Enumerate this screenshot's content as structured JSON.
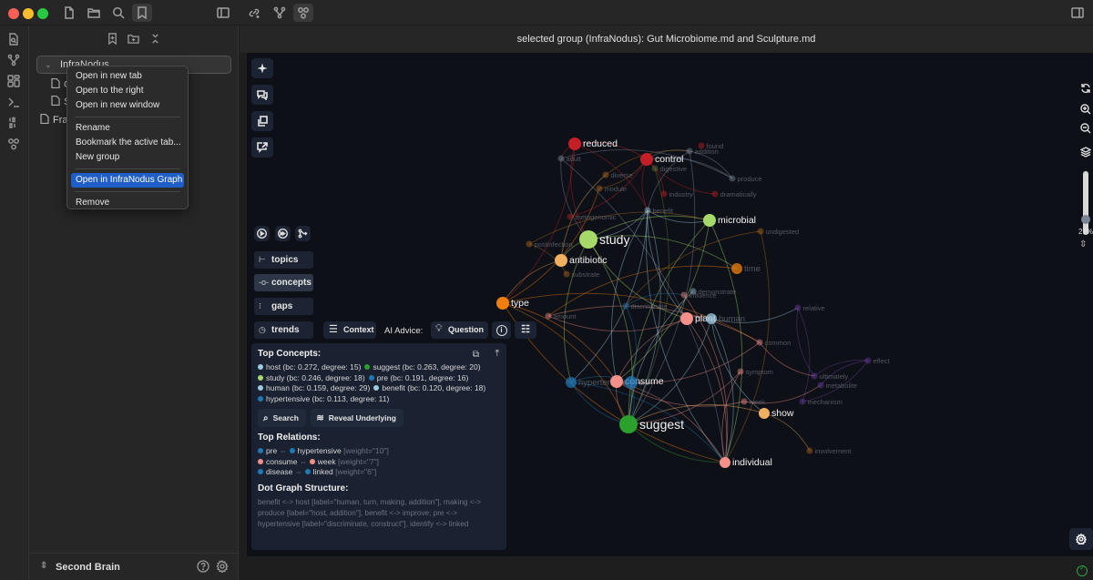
{
  "window": {
    "traffic_lights": {
      "close": "#fe5f57",
      "minimize": "#febc2e",
      "maximize": "#28c840"
    },
    "titlebar_icons": [
      "new-file-icon",
      "folder-icon",
      "search-icon",
      "bookmark-icon",
      "sidebar-toggle-icon",
      "link-plus-icon",
      "graph-icon",
      "infranodus-graph-icon",
      "right-sidebar-toggle-icon"
    ]
  },
  "ribbon": {
    "icons": [
      "file-search-icon",
      "graph-view-icon",
      "dashboard-icon",
      "terminal-icon",
      "binary-icon",
      "infranodus-icon"
    ]
  },
  "sidebar": {
    "header_icons": [
      "bookmark-add-icon",
      "new-folder-icon",
      "collapse-icon"
    ],
    "group": {
      "label": "InfraNodus"
    },
    "files": [
      {
        "label": "G"
      },
      {
        "label": "S"
      }
    ],
    "root_file": {
      "label": "Fra"
    },
    "vault_name": "Second Brain",
    "footer_icons": [
      "help-icon",
      "settings-icon"
    ]
  },
  "context_menu": {
    "items": [
      {
        "label": "Open in new tab"
      },
      {
        "label": "Open to the right"
      },
      {
        "label": "Open in new window"
      },
      {
        "label": "Rename"
      },
      {
        "label": "Bookmark the active tab..."
      },
      {
        "label": "New group"
      },
      {
        "label": "Open in InfraNodus Graph",
        "highlighted": true
      },
      {
        "label": "Remove"
      }
    ],
    "highlight_color": "#1f5ec9"
  },
  "main": {
    "tab_title": "selected group (InfraNodus): Gut Microbiome.md and Sculpture.md",
    "floating_buttons": [
      "sparkle-icon",
      "chat-icon",
      "copy-icon",
      "share-chat-icon"
    ],
    "playback": [
      "play-icon",
      "fast-forward-icon",
      "branch-icon"
    ],
    "view_pills": [
      {
        "label": "topics",
        "icon": "⊢"
      },
      {
        "label": "concepts",
        "icon": "-o-",
        "active": true
      },
      {
        "label": "gaps",
        "icon": "⁝"
      },
      {
        "label": "trends",
        "icon": "◷"
      }
    ],
    "context_button": "Context",
    "ai_advice_label": "AI Advice:",
    "question_button": "Question",
    "zoom_percent": "29%",
    "zoom_slider_value": 0.29
  },
  "panel": {
    "top_concepts_title": "Top Concepts:",
    "concepts": [
      {
        "text": "host (bc: 0.272, degree: 15)",
        "color": "#9ecae1"
      },
      {
        "text": "suggest (bc: 0.263, degree: 20)",
        "color": "#2ca02c"
      },
      {
        "text": "study (bc: 0.246, degree: 18)",
        "color": "#a6d96a"
      },
      {
        "text": "pre (bc: 0.191, degree: 16)",
        "color": "#1f77b4"
      },
      {
        "text": "human (bc: 0.159, degree: 29)",
        "color": "#9ecae1"
      },
      {
        "text": "benefit (bc: 0.120, degree: 18)",
        "color": "#9ecae1"
      },
      {
        "text": "hypertensive (bc: 0.113, degree: 11)",
        "color": "#1f77b4"
      }
    ],
    "search_button": "Search",
    "reveal_button": "Reveal Underlying",
    "top_relations_title": "Top Relations:",
    "relations": [
      {
        "a": "pre",
        "a_color": "#1f77b4",
        "b": "hypertensive",
        "b_color": "#1f77b4",
        "weight": "[weight=\"10\"]"
      },
      {
        "a": "consume",
        "a_color": "#f4908a",
        "b": "week",
        "b_color": "#f4908a",
        "weight": "[weight=\"7\"]"
      },
      {
        "a": "disease",
        "a_color": "#1f77b4",
        "b": "linked",
        "b_color": "#1f77b4",
        "weight": "[weight=\"6\"]"
      }
    ],
    "dot_title": "Dot Graph Structure:",
    "dot_text": "benefit <-> host [label=\"human, turn, making, addition\"], making <-> produce [label=\"host, addition\"], benefit <-> improve; pre <-> hypertensive [label=\"discriminate, construct\"], identify <-> linked"
  },
  "graph": {
    "nodes": [
      {
        "id": "reduced",
        "label": "reduced",
        "color": "#c41e26",
        "size": "medium",
        "prominent": true
      },
      {
        "id": "control",
        "label": "control",
        "color": "#c41e26",
        "size": "medium",
        "prominent": true
      },
      {
        "id": "found",
        "label": "found",
        "color": "#c41e26",
        "size": "tiny"
      },
      {
        "id": "addition",
        "label": "addition",
        "color": "#7a8a99",
        "size": "tiny"
      },
      {
        "id": "adult",
        "label": "adult",
        "color": "#7a8a99",
        "size": "tiny"
      },
      {
        "id": "produce",
        "label": "produce",
        "color": "#7a8a99",
        "size": "tiny"
      },
      {
        "id": "digestive",
        "label": "digestive",
        "color": "#5b7a3a",
        "size": "tiny"
      },
      {
        "id": "diverse",
        "label": "diverse",
        "color": "#b0691e",
        "size": "tiny"
      },
      {
        "id": "module",
        "label": "module",
        "color": "#b0691e",
        "size": "tiny"
      },
      {
        "id": "dramatically",
        "label": "dramatically",
        "color": "#c41e26",
        "size": "tiny"
      },
      {
        "id": "industry",
        "label": "industry",
        "color": "#c41e26",
        "size": "tiny"
      },
      {
        "id": "benefit",
        "label": "benefit",
        "color": "#9ecae1",
        "size": "tiny"
      },
      {
        "id": "metagenomic",
        "label": "metagenomic",
        "color": "#c41e26",
        "size": "tiny"
      },
      {
        "id": "microbial",
        "label": "microbial",
        "color": "#a6d96a",
        "size": "medium",
        "prominent": true
      },
      {
        "id": "undigested",
        "label": "undigested",
        "color": "#b0691e",
        "size": "tiny"
      },
      {
        "id": "study",
        "label": "study",
        "color": "#a6d96a",
        "size": "large",
        "prominent": true
      },
      {
        "id": "postinfection",
        "label": "postinfection",
        "color": "#b0691e",
        "size": "tiny"
      },
      {
        "id": "antibiotic",
        "label": "antibiotic",
        "color": "#f0b060",
        "size": "medium",
        "prominent": true
      },
      {
        "id": "time",
        "label": "time",
        "color": "#f07f0e",
        "size": "small"
      },
      {
        "id": "substrate",
        "label": "substrate",
        "color": "#b0691e",
        "size": "tiny"
      },
      {
        "id": "type",
        "label": "type",
        "color": "#f07f0e",
        "size": "medium",
        "prominent": true
      },
      {
        "id": "influence",
        "label": "influence",
        "color": "#f4908a",
        "size": "tiny"
      },
      {
        "id": "demonstrate",
        "label": "demonstrate",
        "color": "#9ecae1",
        "size": "tiny"
      },
      {
        "id": "discriminate",
        "label": "discriminate",
        "color": "#1f77b4",
        "size": "tiny"
      },
      {
        "id": "amount",
        "label": "amount",
        "color": "#f4908a",
        "size": "tiny"
      },
      {
        "id": "plant",
        "label": "plant",
        "color": "#f4908a",
        "size": "medium",
        "prominent": true
      },
      {
        "id": "human",
        "label": "human",
        "color": "#9ecae1",
        "size": "small"
      },
      {
        "id": "relative",
        "label": "relative",
        "color": "#6b3fa0",
        "size": "tiny"
      },
      {
        "id": "common",
        "label": "common",
        "color": "#f4908a",
        "size": "tiny"
      },
      {
        "id": "effect",
        "label": "effect",
        "color": "#6b3fa0",
        "size": "tiny"
      },
      {
        "id": "symptom",
        "label": "symptom",
        "color": "#f4908a",
        "size": "tiny"
      },
      {
        "id": "ultimately",
        "label": "ultimately",
        "color": "#6b3fa0",
        "size": "tiny"
      },
      {
        "id": "metabolite",
        "label": "metabolite",
        "color": "#6b3fa0",
        "size": "tiny"
      },
      {
        "id": "mechanism",
        "label": "mechanism",
        "color": "#6b3fa0",
        "size": "tiny"
      },
      {
        "id": "hypertensive",
        "label": "hypertensive",
        "color": "#1f77b4",
        "size": "small"
      },
      {
        "id": "consume",
        "label": "consume",
        "color": "#f4908a",
        "size": "medium",
        "prominent": true
      },
      {
        "id": "pre",
        "label": "pre",
        "color": "#1f77b4",
        "size": "medium"
      },
      {
        "id": "week",
        "label": "week",
        "color": "#f4908a",
        "size": "tiny"
      },
      {
        "id": "show",
        "label": "show",
        "color": "#f0b060",
        "size": "small",
        "prominent": true
      },
      {
        "id": "suggest",
        "label": "suggest",
        "color": "#2ca02c",
        "size": "large",
        "prominent": true
      },
      {
        "id": "involvement",
        "label": "involvement",
        "color": "#b0691e",
        "size": "tiny"
      },
      {
        "id": "individual",
        "label": "individual",
        "color": "#f4908a",
        "size": "small",
        "prominent": true
      }
    ]
  },
  "status": {
    "sync_icon": "sync-ok-icon",
    "sync_color": "#2ea043"
  }
}
